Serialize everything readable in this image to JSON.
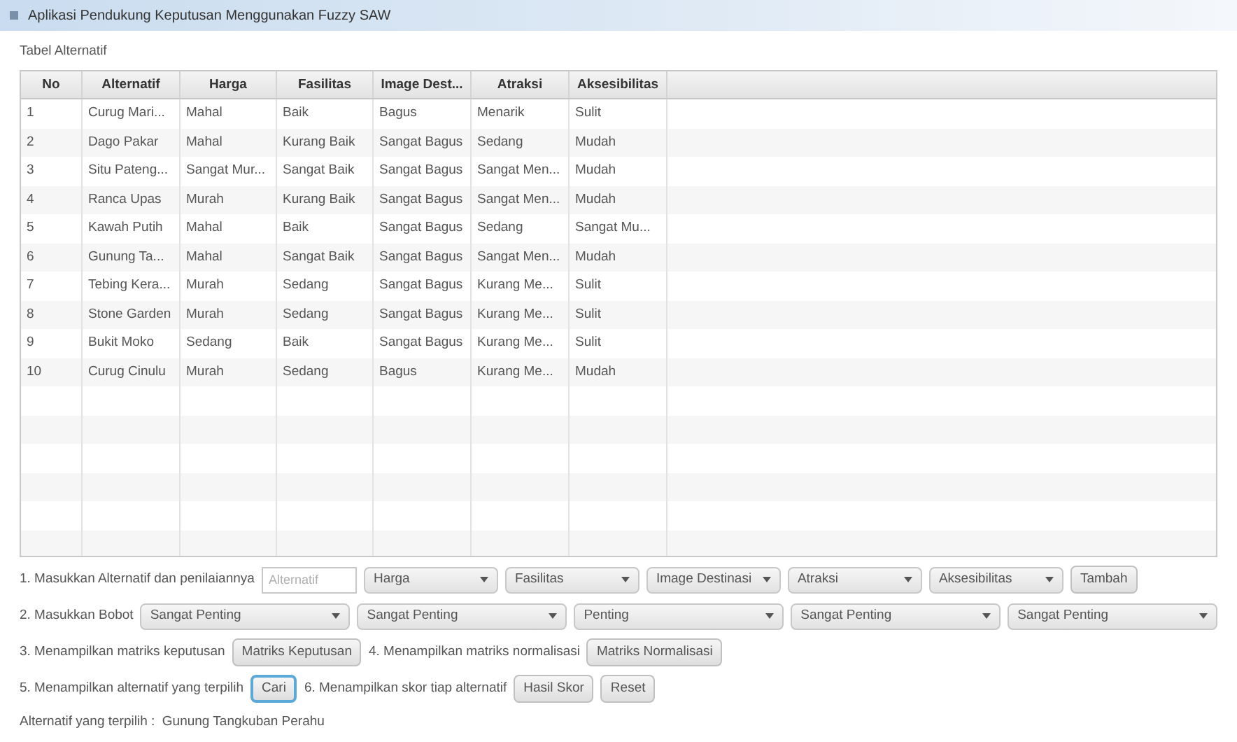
{
  "window": {
    "title": "Aplikasi Pendukung Keputusan Menggunakan Fuzzy SAW"
  },
  "table_label": "Tabel Alternatif",
  "table": {
    "columns": [
      "No",
      "Alternatif",
      "Harga",
      "Fasilitas",
      "Image Dest...",
      "Atraksi",
      "Aksesibilitas"
    ],
    "rows": [
      [
        "1",
        "Curug Mari...",
        "Mahal",
        "Baik",
        "Bagus",
        "Menarik",
        "Sulit"
      ],
      [
        "2",
        "Dago Pakar",
        "Mahal",
        "Kurang Baik",
        "Sangat Bagus",
        "Sedang",
        "Mudah"
      ],
      [
        "3",
        "Situ Pateng...",
        "Sangat Mur...",
        "Sangat Baik",
        "Sangat Bagus",
        "Sangat Men...",
        "Mudah"
      ],
      [
        "4",
        "Ranca Upas",
        "Murah",
        "Kurang Baik",
        "Sangat Bagus",
        "Sangat Men...",
        "Mudah"
      ],
      [
        "5",
        "Kawah Putih",
        "Mahal",
        "Baik",
        "Sangat Bagus",
        "Sedang",
        "Sangat Mu..."
      ],
      [
        "6",
        "Gunung Ta...",
        "Mahal",
        "Sangat Baik",
        "Sangat Bagus",
        "Sangat Men...",
        "Mudah"
      ],
      [
        "7",
        "Tebing Kera...",
        "Murah",
        "Sedang",
        "Sangat Bagus",
        "Kurang Me...",
        "Sulit"
      ],
      [
        "8",
        "Stone Garden",
        "Murah",
        "Sedang",
        "Sangat Bagus",
        "Kurang Me...",
        "Sulit"
      ],
      [
        "9",
        "Bukit Moko",
        "Sedang",
        "Baik",
        "Sangat Bagus",
        "Kurang Me...",
        "Sulit"
      ],
      [
        "10",
        "Curug Cinulu",
        "Murah",
        "Sedang",
        "Bagus",
        "Kurang Me...",
        "Mudah"
      ]
    ]
  },
  "form_rows": [
    {
      "items": [
        {
          "kind": "label",
          "text": "1. Masukkan Alternatif dan penilaiannya"
        },
        {
          "kind": "input",
          "placeholder": "Alternatif"
        },
        {
          "kind": "select",
          "value": "Harga"
        },
        {
          "kind": "select",
          "value": "Fasilitas"
        },
        {
          "kind": "select",
          "value": "Image Destinasi"
        },
        {
          "kind": "select",
          "value": "Atraksi"
        },
        {
          "kind": "select",
          "value": "Aksesibilitas"
        },
        {
          "kind": "button",
          "text": "Tambah",
          "focused": false
        }
      ]
    },
    {
      "items": [
        {
          "kind": "label",
          "text": "2. Masukkan Bobot"
        },
        {
          "kind": "select",
          "value": "Sangat Penting"
        },
        {
          "kind": "select",
          "value": "Sangat Penting"
        },
        {
          "kind": "select",
          "value": "Penting"
        },
        {
          "kind": "select",
          "value": "Sangat Penting"
        },
        {
          "kind": "select",
          "value": "Sangat Penting"
        }
      ]
    },
    {
      "items": [
        {
          "kind": "label",
          "text": "3. Menampilkan matriks keputusan"
        },
        {
          "kind": "button",
          "text": "Matriks Keputusan",
          "focused": false
        },
        {
          "kind": "label",
          "text": "4. Menampilkan matriks normalisasi"
        },
        {
          "kind": "button",
          "text": "Matriks Normalisasi",
          "focused": false
        }
      ]
    },
    {
      "items": [
        {
          "kind": "label",
          "text": "5. Menampilkan alternatif yang terpilih"
        },
        {
          "kind": "button",
          "text": "Cari",
          "focused": true
        },
        {
          "kind": "label",
          "text": "6. Menampilkan skor tiap alternatif"
        },
        {
          "kind": "button",
          "text": "Hasil Skor",
          "focused": false
        },
        {
          "kind": "button",
          "text": "Reset",
          "focused": false
        }
      ]
    }
  ],
  "result": "Alternatif yang terpilih :  Gunung Tangkuban Perahu"
}
